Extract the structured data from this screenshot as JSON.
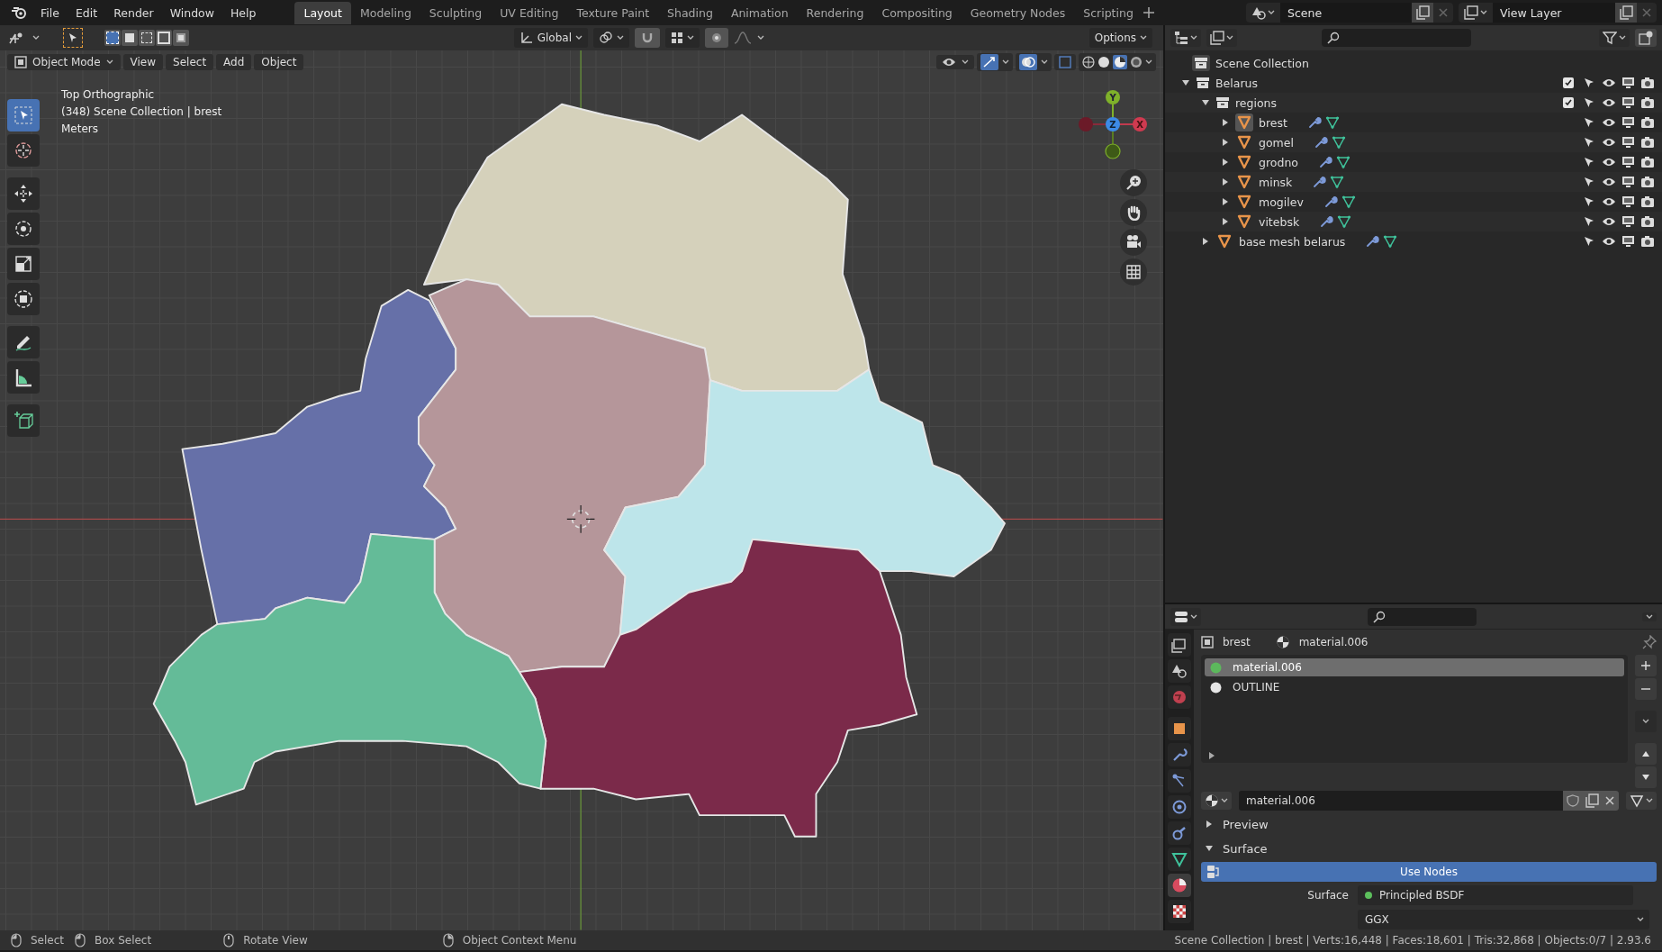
{
  "menu": [
    "File",
    "Edit",
    "Render",
    "Window",
    "Help"
  ],
  "workspaces": [
    {
      "label": "Layout",
      "selected": true
    },
    {
      "label": "Modeling",
      "selected": false
    },
    {
      "label": "Sculpting",
      "selected": false
    },
    {
      "label": "UV Editing",
      "selected": false
    },
    {
      "label": "Texture Paint",
      "selected": false
    },
    {
      "label": "Shading",
      "selected": false
    },
    {
      "label": "Animation",
      "selected": false
    },
    {
      "label": "Rendering",
      "selected": false
    },
    {
      "label": "Compositing",
      "selected": false
    },
    {
      "label": "Geometry Nodes",
      "selected": false
    },
    {
      "label": "Scripting",
      "selected": false
    }
  ],
  "scene": "Scene",
  "view_layer": "View Layer",
  "tool_header": {
    "orientation": "Global",
    "options": "Options"
  },
  "viewport_header": {
    "mode": "Object Mode",
    "menus": [
      "View",
      "Select",
      "Add",
      "Object"
    ]
  },
  "overlay_text": [
    "Top Orthographic",
    "(348) Scene Collection | brest",
    "Meters"
  ],
  "gizmo": {
    "y": "Y",
    "z": "Z",
    "x": "X"
  },
  "outliner": {
    "root": "Scene Collection",
    "items": [
      {
        "name": "Belarus",
        "kind": "collection",
        "expanded": true,
        "checked": true,
        "children": [
          {
            "name": "regions",
            "kind": "collection",
            "expanded": true,
            "checked": true,
            "children": [
              {
                "name": "brest",
                "kind": "mesh",
                "expanded": false,
                "active": true
              },
              {
                "name": "gomel",
                "kind": "mesh",
                "expanded": false,
                "active": false
              },
              {
                "name": "grodno",
                "kind": "mesh",
                "expanded": false,
                "active": false
              },
              {
                "name": "minsk",
                "kind": "mesh",
                "expanded": false,
                "active": false
              },
              {
                "name": "mogilev",
                "kind": "mesh",
                "expanded": false,
                "active": false
              },
              {
                "name": "vitebsk",
                "kind": "mesh",
                "expanded": false,
                "active": false
              }
            ]
          },
          {
            "name": "base mesh belarus",
            "kind": "mesh",
            "expanded": false,
            "active": false
          }
        ]
      }
    ]
  },
  "properties": {
    "breadcrumb": [
      "brest",
      "material.006"
    ],
    "slots": [
      {
        "name": "material.006",
        "selected": true,
        "color": "#5cb85c"
      },
      {
        "name": "OUTLINE",
        "selected": false,
        "color": "#e6e6e6"
      }
    ],
    "material_name": "material.006",
    "panels": [
      {
        "label": "Preview",
        "expanded": false
      },
      {
        "label": "Surface",
        "expanded": true
      }
    ],
    "use_nodes": "Use Nodes",
    "surface_label": "Surface",
    "surface_value": "Principled BSDF",
    "distribution": "GGX"
  },
  "status_bar": {
    "hints": [
      "Select",
      "Box Select",
      "Rotate View",
      "Object Context Menu"
    ],
    "stats": "Scene Collection | brest | Verts:16,448 | Faces:18,601 | Tris:32,868 | Objects:0/7 | 2.93.6"
  }
}
